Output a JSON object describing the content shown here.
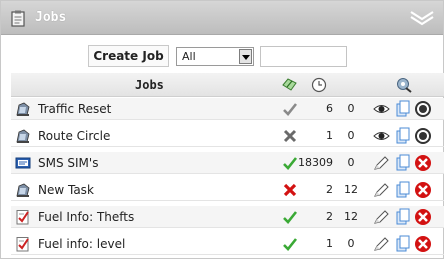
{
  "window": {
    "title": "Jobs"
  },
  "toolbar": {
    "create_label": "Create Job",
    "filter_value": "All",
    "search_value": ""
  },
  "table": {
    "column_title": "Jobs",
    "rows": [
      {
        "name": "Traffic Reset",
        "type": "dispatch-icon",
        "status": "check-grey-icon",
        "count1": "6",
        "count2": "0",
        "action": "view-icon",
        "delete_style": "grey"
      },
      {
        "name": "Route Circle",
        "type": "dispatch-icon",
        "status": "cross-grey-icon",
        "count1": "1",
        "count2": "0",
        "action": "view-icon",
        "delete_style": "grey"
      },
      {
        "name": "SMS SIM's",
        "type": "sms-icon",
        "status": "check-green-icon",
        "count1": "18309",
        "count2": "0",
        "action": "edit-icon",
        "delete_style": "red"
      },
      {
        "name": "New Task",
        "type": "dispatch-icon",
        "status": "cross-red-icon",
        "count1": "2",
        "count2": "12",
        "action": "edit-icon",
        "delete_style": "red"
      },
      {
        "name": "Fuel Info: Thefts",
        "type": "report-icon",
        "status": "check-green-icon",
        "count1": "2",
        "count2": "12",
        "action": "edit-icon",
        "delete_style": "red"
      },
      {
        "name": "Fuel info: level",
        "type": "report-icon",
        "status": "check-green-icon",
        "count1": "1",
        "count2": "0",
        "action": "edit-icon",
        "delete_style": "red"
      }
    ]
  },
  "colors": {
    "green": "#3aa935",
    "red": "#d31212",
    "grey": "#8a8a8a",
    "copy_blue": "#4b8bd6"
  }
}
